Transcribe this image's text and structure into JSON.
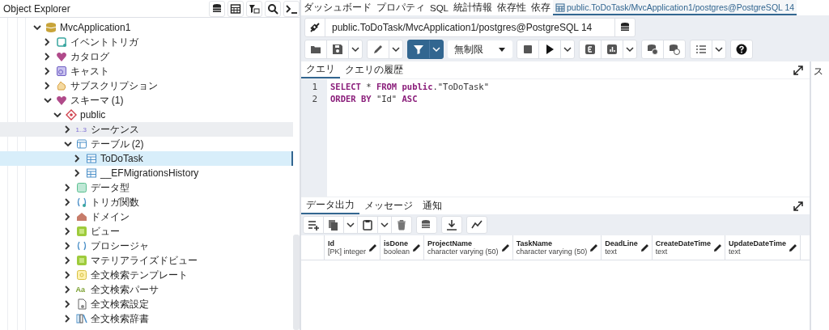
{
  "explorer": {
    "title": "Object Explorer",
    "tree": [
      {
        "label": "MvcApplication1",
        "kind": "database",
        "expanded": true,
        "selected": false,
        "hovered": false,
        "children": [
          {
            "label": "イベントトリガ",
            "kind": "event-trigger",
            "expanded": false,
            "selected": false,
            "hovered": false
          },
          {
            "label": "カタログ",
            "kind": "catalog",
            "expanded": false,
            "selected": false,
            "hovered": false
          },
          {
            "label": "キャスト",
            "kind": "cast",
            "expanded": false,
            "selected": false,
            "hovered": false
          },
          {
            "label": "サブスクリプション",
            "kind": "subscription",
            "expanded": false,
            "selected": false,
            "hovered": false
          },
          {
            "label": "スキーマ (1)",
            "kind": "catalog",
            "expanded": true,
            "selected": false,
            "hovered": false,
            "children": [
              {
                "label": "public",
                "kind": "schema",
                "expanded": true,
                "selected": false,
                "hovered": false,
                "children": [
                  {
                    "label": "シーケンス",
                    "kind": "sequence",
                    "icon_text": "1..3",
                    "expanded": false,
                    "selected": false,
                    "hovered": true
                  },
                  {
                    "label": "テーブル (2)",
                    "kind": "table-group",
                    "expanded": true,
                    "selected": false,
                    "hovered": false,
                    "children": [
                      {
                        "label": "ToDoTask",
                        "kind": "table",
                        "expanded": false,
                        "selected": true,
                        "hovered": false
                      },
                      {
                        "label": "__EFMigrationsHistory",
                        "kind": "table",
                        "expanded": false,
                        "selected": false,
                        "hovered": false
                      }
                    ]
                  },
                  {
                    "label": "データ型",
                    "kind": "type",
                    "expanded": false,
                    "selected": false,
                    "hovered": false
                  },
                  {
                    "label": "トリガ関数",
                    "kind": "trigger-function",
                    "expanded": false,
                    "selected": false,
                    "hovered": false
                  },
                  {
                    "label": "ドメイン",
                    "kind": "domain",
                    "expanded": false,
                    "selected": false,
                    "hovered": false
                  },
                  {
                    "label": "ビュー",
                    "kind": "view",
                    "expanded": false,
                    "selected": false,
                    "hovered": false
                  },
                  {
                    "label": "プロシージャ",
                    "kind": "procedure",
                    "expanded": false,
                    "selected": false,
                    "hovered": false
                  },
                  {
                    "label": "マテリアライズドビュー",
                    "kind": "view",
                    "expanded": false,
                    "selected": false,
                    "hovered": false
                  },
                  {
                    "label": "全文検索テンプレート",
                    "kind": "fts-template",
                    "expanded": false,
                    "selected": false,
                    "hovered": false
                  },
                  {
                    "label": "全文検索パーサ",
                    "kind": "fts-parser",
                    "icon_text": "Aa",
                    "expanded": false,
                    "selected": false,
                    "hovered": false
                  },
                  {
                    "label": "全文検索設定",
                    "kind": "document",
                    "expanded": false,
                    "selected": false,
                    "hovered": false
                  },
                  {
                    "label": "全文検索辞書",
                    "kind": "dictionary",
                    "expanded": false,
                    "selected": false,
                    "hovered": false
                  }
                ]
              }
            ]
          }
        ]
      }
    ]
  },
  "top_tabs": [
    {
      "label": "ダッシュボード",
      "selected": false
    },
    {
      "label": "プロパティ",
      "selected": false
    },
    {
      "label": "SQL",
      "selected": false
    },
    {
      "label": "統計情報",
      "selected": false
    },
    {
      "label": "依存性",
      "selected": false
    },
    {
      "label": "依存",
      "selected": false
    },
    {
      "label": "public.ToDoTask/MvcApplication1/postgres@PostgreSQL 14",
      "selected": true
    }
  ],
  "connection": {
    "label": "public.ToDoTask/MvcApplication1/postgres@PostgreSQL 14"
  },
  "row_limit": {
    "value": "無制限"
  },
  "query_tabs": [
    {
      "label": "クエリ",
      "selected": true
    },
    {
      "label": "クエリの履歴",
      "selected": false
    }
  ],
  "side_panel_tab": {
    "label": "ス"
  },
  "editor": {
    "lines": [
      {
        "number": "1",
        "tokens": [
          {
            "text": "SELECT",
            "kind": "keyword"
          },
          {
            "text": " * ",
            "kind": "plain"
          },
          {
            "text": "FROM",
            "kind": "keyword"
          },
          {
            "text": " public",
            "kind": "keyword"
          },
          {
            "text": ".\"ToDoTask\"",
            "kind": "plain"
          }
        ]
      },
      {
        "number": "2",
        "tokens": [
          {
            "text": "ORDER BY",
            "kind": "keyword"
          },
          {
            "text": " \"Id\" ",
            "kind": "plain"
          },
          {
            "text": "ASC",
            "kind": "keyword"
          }
        ]
      }
    ]
  },
  "output_tabs": [
    {
      "label": "データ出力",
      "selected": true
    },
    {
      "label": "メッセージ",
      "selected": false
    },
    {
      "label": "通知",
      "selected": false
    }
  ],
  "columns": [
    {
      "name": "Id",
      "type": "[PK] integer"
    },
    {
      "name": "isDone",
      "type": "boolean"
    },
    {
      "name": "ProjectName",
      "type": "character varying (50)"
    },
    {
      "name": "TaskName",
      "type": "character varying (50)"
    },
    {
      "name": "DeadLine",
      "type": "text"
    },
    {
      "name": "CreateDateTime",
      "type": "text"
    },
    {
      "name": "UpdateDateTime",
      "type": "text"
    }
  ]
}
